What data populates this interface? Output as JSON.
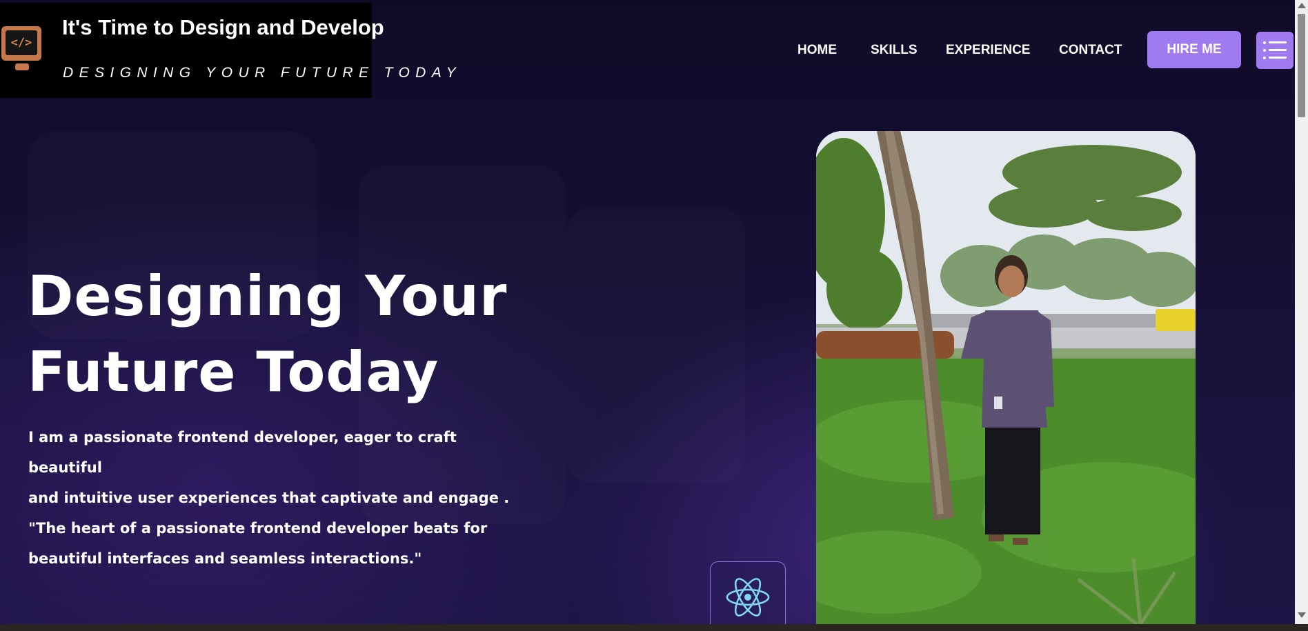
{
  "logo": {
    "title": "It's Time to Design and Develop",
    "subtitle": "DESIGNING YOUR FUTURE TODAY",
    "icon": "code-monitor-icon",
    "icon_text": "</>"
  },
  "nav": {
    "items": [
      {
        "label": "HOME"
      },
      {
        "label": "SKILLS"
      },
      {
        "label": "EXPERIENCE"
      },
      {
        "label": "CONTACT"
      }
    ],
    "hire_label": "HIRE ME",
    "menu_icon": "list-menu-icon"
  },
  "hero": {
    "title_line1": "Designing Your",
    "title_line2": "Future Today",
    "desc_line1": "I am a passionate frontend developer, eager to craft beautiful",
    "desc_line2": "and intuitive user experiences that captivate and engage .",
    "desc_line3": "\"The heart of a passionate frontend developer beats for",
    "desc_line4": "beautiful interfaces and seamless interactions.\""
  },
  "icons": {
    "react": "react-atom-icon"
  },
  "colors": {
    "accent": "#a07bf0",
    "background": "#120d2e",
    "logo_orange": "#c7784a"
  }
}
